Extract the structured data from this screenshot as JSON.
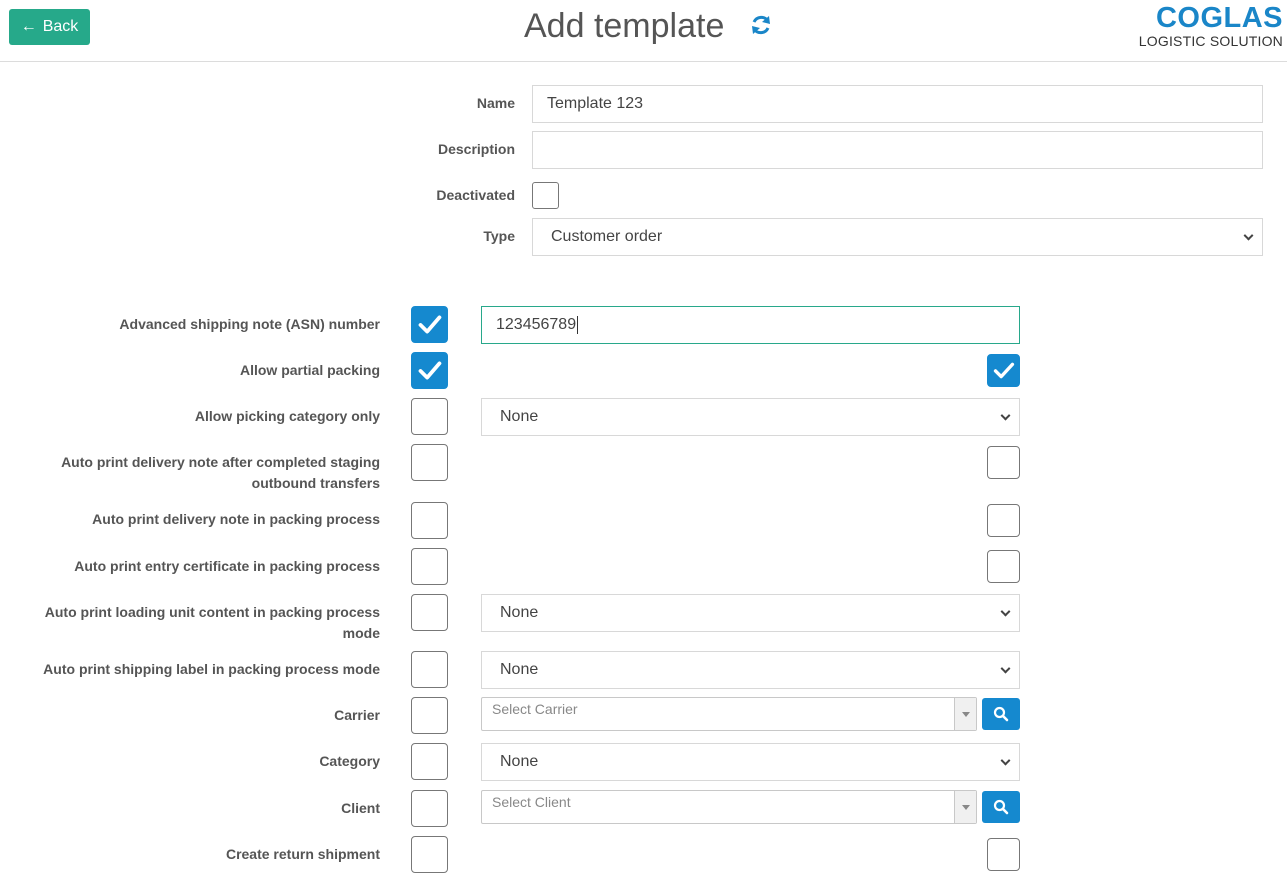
{
  "header": {
    "back_label": "Back",
    "title": "Add template",
    "logo_brand": "COGLAS",
    "logo_sub": "LOGISTIC SOLUTION"
  },
  "form": {
    "name_label": "Name",
    "name_value": "Template 123",
    "description_label": "Description",
    "description_value": "",
    "deactivated_label": "Deactivated",
    "type_label": "Type",
    "type_value": "Customer order"
  },
  "rows": {
    "asn_label": "Advanced shipping note (ASN) number",
    "asn_value": "123456789",
    "partial_label": "Allow partial packing",
    "picking_cat_label": "Allow picking category only",
    "picking_cat_value": "None",
    "auto_delivery_staging_label_1": "Auto print delivery note after completed staging",
    "auto_delivery_staging_label_2": "outbound transfers",
    "auto_delivery_packing_label": "Auto print delivery note in packing process",
    "auto_entry_cert_label": "Auto print entry certificate in packing process",
    "auto_loading_unit_label_1": "Auto print loading unit content in packing process",
    "auto_loading_unit_label_2": "mode",
    "auto_loading_unit_value": "None",
    "auto_shipping_label_label": "Auto print shipping label in packing process mode",
    "auto_shipping_label_value": "None",
    "carrier_label": "Carrier",
    "carrier_placeholder": "Select Carrier",
    "category_label": "Category",
    "category_value": "None",
    "client_label": "Client",
    "client_placeholder": "Select Client",
    "return_shipment_label": "Create return shipment"
  },
  "colors": {
    "accent_green": "#26a98a",
    "accent_blue": "#1589cf",
    "brand_blue": "#1a86c8"
  },
  "icons": [
    "arrow-left-icon",
    "refresh-icon",
    "check-icon",
    "search-icon",
    "chevron-down-icon"
  ]
}
